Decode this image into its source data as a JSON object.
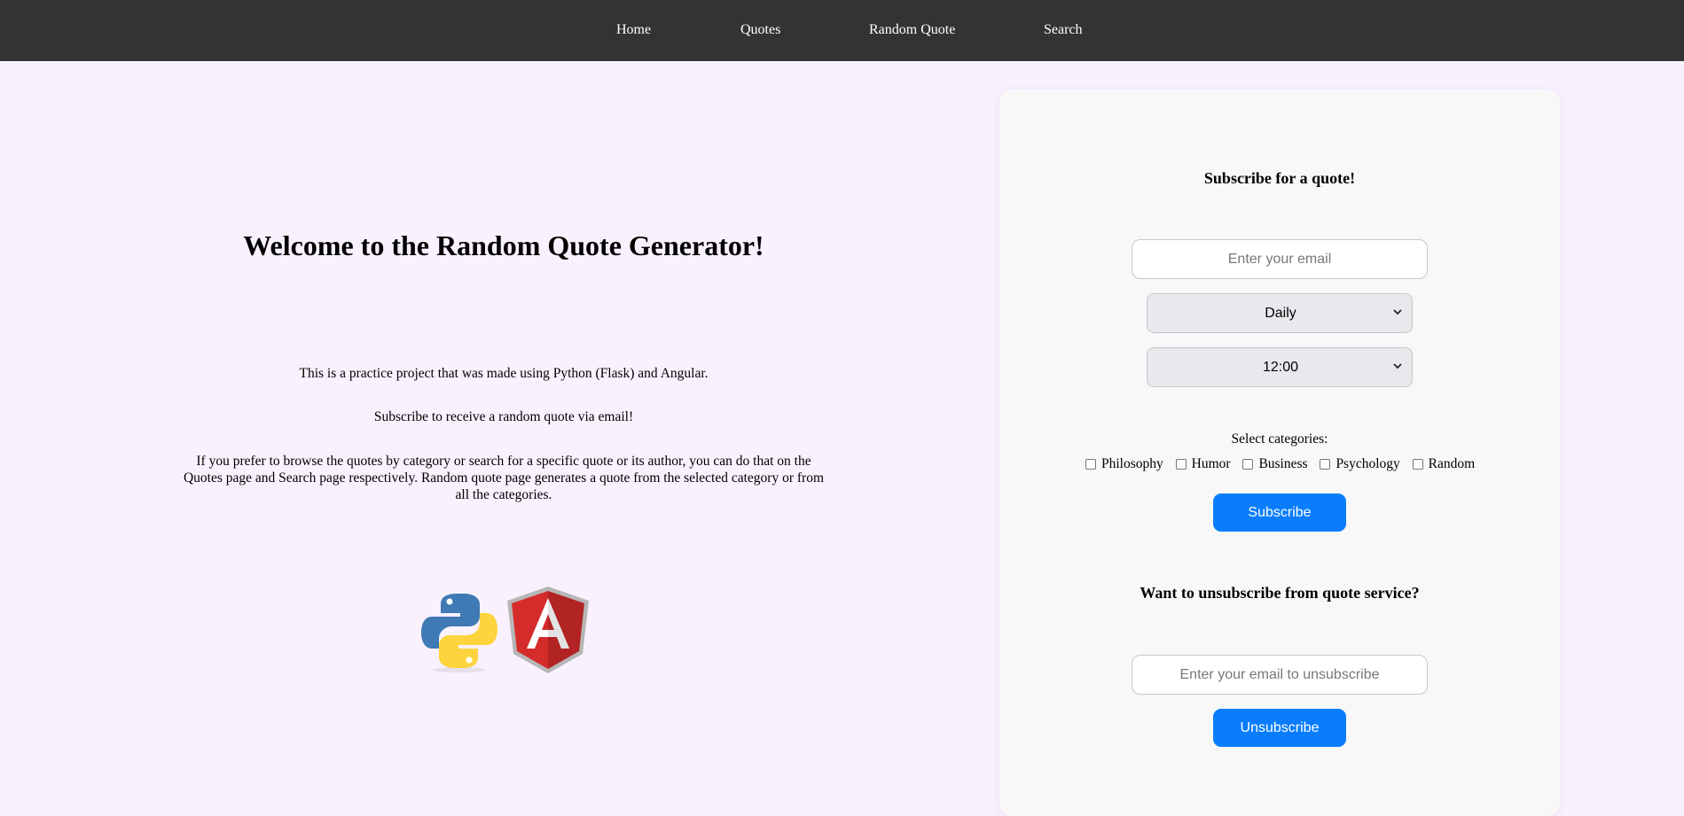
{
  "nav": {
    "items": [
      {
        "label": "Home"
      },
      {
        "label": "Quotes"
      },
      {
        "label": "Random Quote"
      },
      {
        "label": "Search"
      }
    ]
  },
  "intro": {
    "title": "Welcome to the Random Quote Generator!",
    "paragraph1": "This is a practice project that was made using Python (Flask) and Angular.",
    "paragraph2": "Subscribe to receive a random quote via email!",
    "paragraph3": "If you prefer to browse the quotes by category or search for a specific quote or its author, you can do that on the Quotes page and Search page respectively. Random quote page generates a quote from the selected category or from all the categories."
  },
  "logos": [
    {
      "name": "python-logo"
    },
    {
      "name": "angular-logo",
      "letter": "A"
    }
  ],
  "subscribe": {
    "heading": "Subscribe for a quote!",
    "email_placeholder": "Enter your email",
    "frequency_value": "Daily",
    "time_value": "12:00",
    "categories_label": "Select categories:",
    "categories": [
      {
        "label": "Philosophy"
      },
      {
        "label": "Humor"
      },
      {
        "label": "Business"
      },
      {
        "label": "Psychology"
      },
      {
        "label": "Random"
      }
    ],
    "button_label": "Subscribe"
  },
  "unsubscribe": {
    "heading": "Want to unsubscribe from quote service?",
    "email_placeholder": "Enter your email to unsubscribe",
    "button_label": "Unsubscribe"
  },
  "colors": {
    "navbar": "#333333",
    "page_background": "#f9f2fe",
    "card_background": "#f8f8f8",
    "button": "#0a7dfd"
  }
}
